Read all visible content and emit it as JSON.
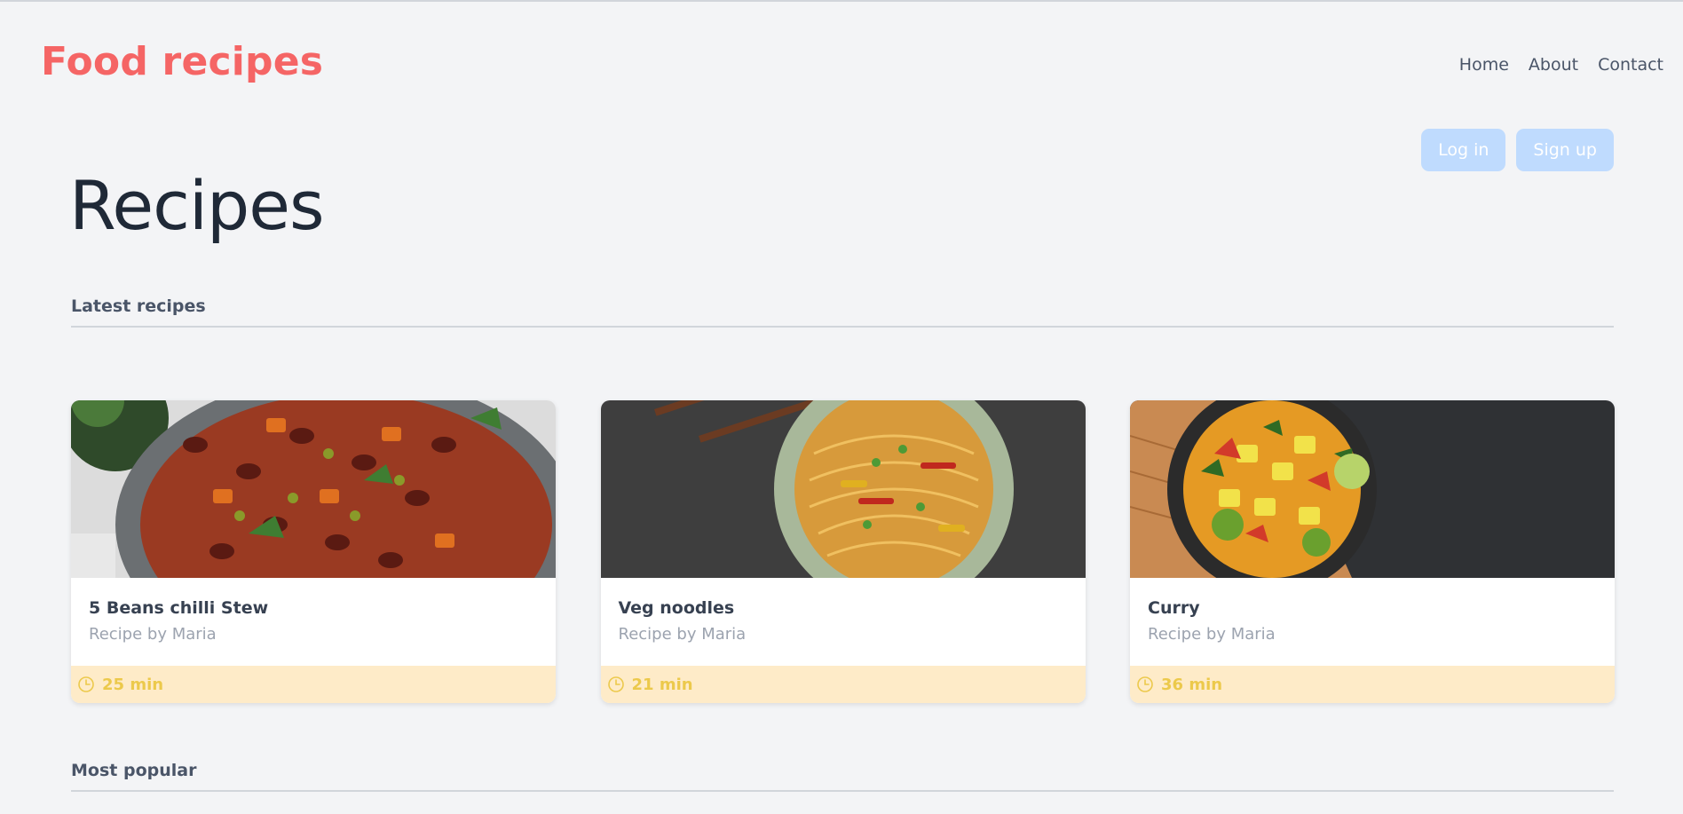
{
  "header": {
    "brand": "Food recipes",
    "nav": [
      "Home",
      "About",
      "Contact"
    ],
    "login_label": "Log in",
    "signup_label": "Sign up"
  },
  "page_title": "Recipes",
  "sections": {
    "latest": "Latest recipes",
    "popular": "Most popular"
  },
  "recipes": [
    {
      "title": "5 Beans chilli Stew",
      "author": "Recipe by Maria",
      "time": "25 min",
      "image": "bean-stew-photo"
    },
    {
      "title": "Veg noodles",
      "author": "Recipe by Maria",
      "time": "21 min",
      "image": "noodles-photo"
    },
    {
      "title": "Curry",
      "author": "Recipe by Maria",
      "time": "36 min",
      "image": "curry-photo"
    }
  ],
  "colors": {
    "brand": "#f56565",
    "auth_button": "#bfdbfe",
    "time_band": "#feebc8",
    "time_text": "#ecc94b"
  },
  "icons": {
    "time": "clock-icon"
  }
}
